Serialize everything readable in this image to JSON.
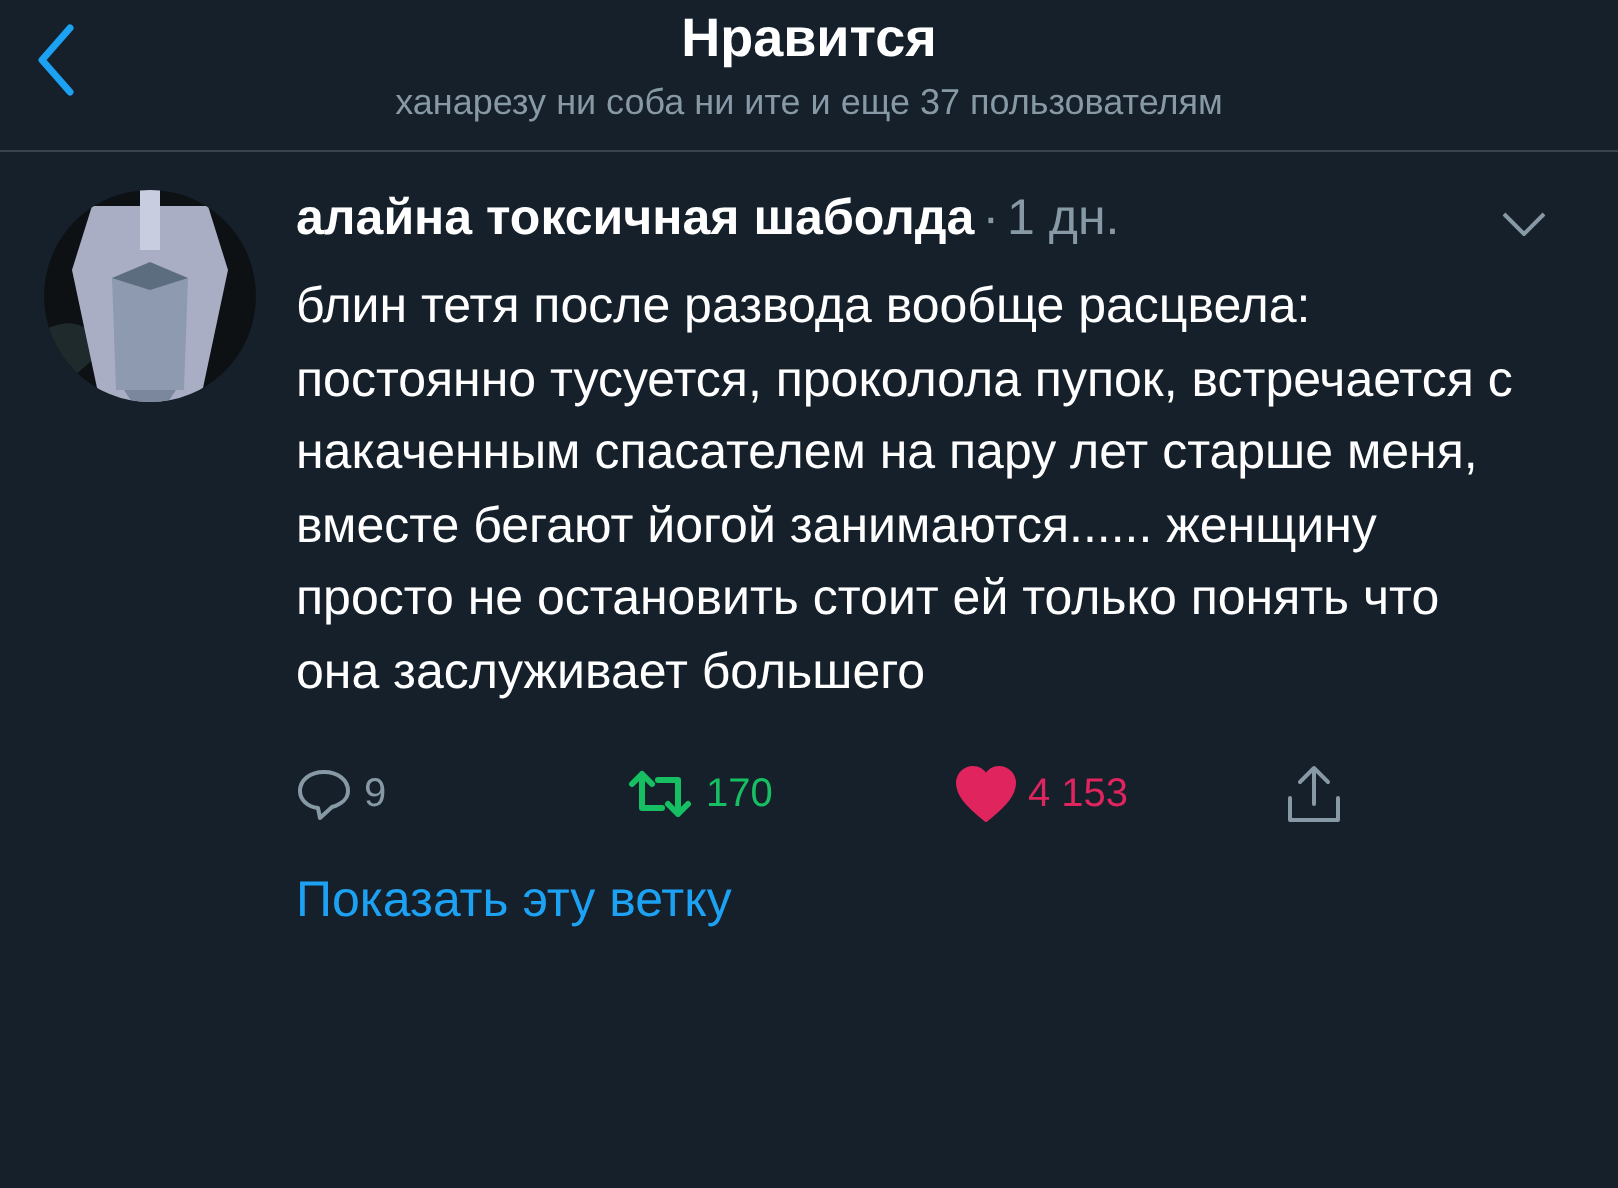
{
  "header": {
    "title": "Нравится",
    "subtitle": "ханарезу ни соба ни ите и еще 37 пользователям"
  },
  "tweet": {
    "author": "алайна токсичная шаболда",
    "separator": "·",
    "time": "1 дн.",
    "text": "блин тетя после развода вообще расцвела: постоянно тусуется, проколола пупок, встречается с накаченным спасателем на пару лет старше меня, вместе бегают йогой занимаются...... женщину просто не остановить стоит ей только понять что она заслуживает большего",
    "actions": [
      {
        "kind": "reply",
        "count": "9",
        "selected": false
      },
      {
        "kind": "retweet",
        "count": "170",
        "selected": true
      },
      {
        "kind": "like",
        "count": "4 153",
        "selected": true
      },
      {
        "kind": "share",
        "selected": false
      }
    ],
    "thread_link": "Показать эту ветку"
  }
}
